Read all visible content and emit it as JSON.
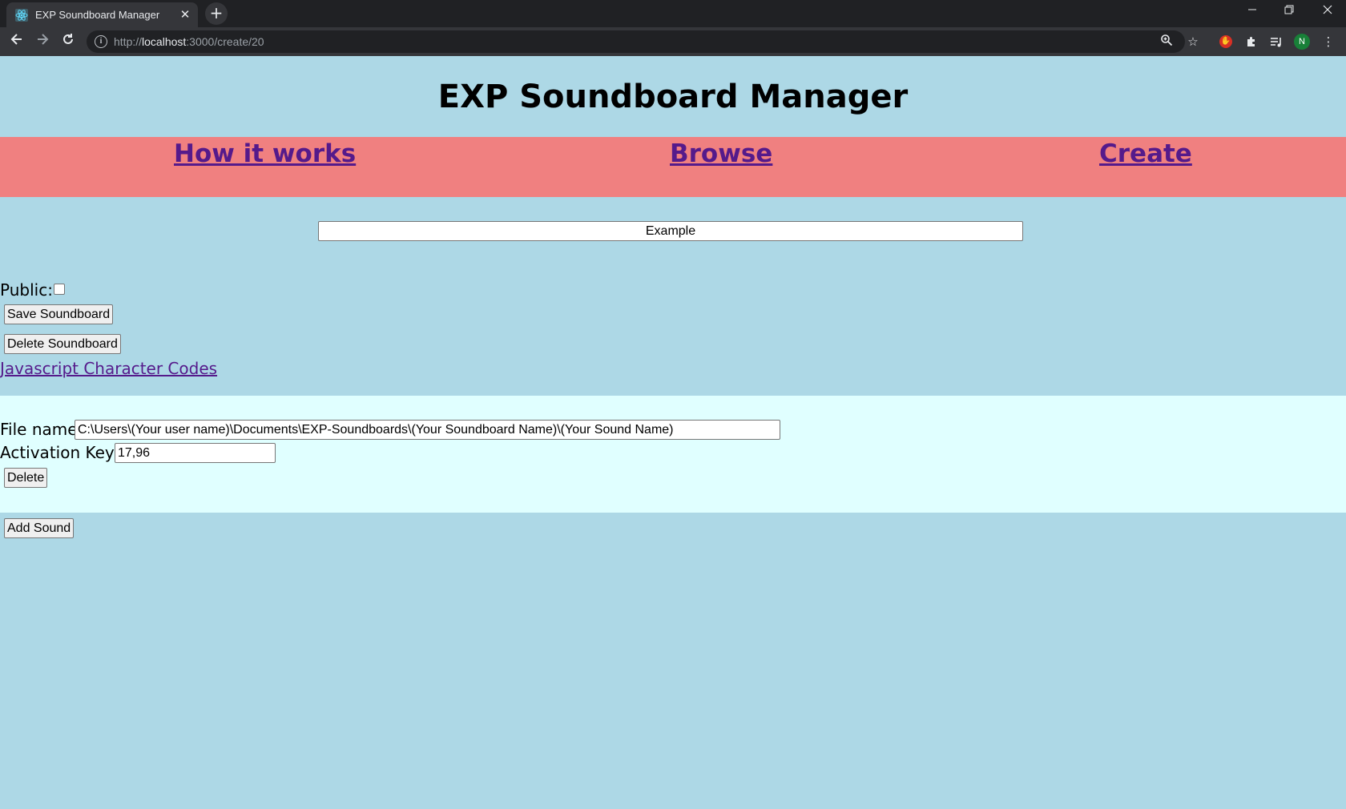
{
  "browser": {
    "tab_title": "EXP Soundboard Manager",
    "url_scheme": "http://",
    "url_host": "localhost",
    "url_rest": ":3000/create/20",
    "profile_initial": "N",
    "icons": {
      "back": "back-arrow-icon",
      "forward": "forward-arrow-icon",
      "reload": "reload-icon",
      "zoom": "zoom-icon",
      "bookmark": "star-icon",
      "menu": "kebab-menu-icon"
    }
  },
  "header": {
    "title": "EXP Soundboard Manager"
  },
  "nav": {
    "how_it_works": "How it works",
    "browse": "Browse",
    "create": "Create"
  },
  "soundboard": {
    "name_value": "Example",
    "public_label": "Public:",
    "public_checked": false,
    "save_label": "Save Soundboard",
    "delete_label": "Delete Soundboard",
    "codes_link": "Javascript Character Codes"
  },
  "sound": {
    "file_name_label": "File name:",
    "file_name_value": "C:\\Users\\(Your user name)\\Documents\\EXP-Soundboards\\(Your Soundboard Name)\\(Your Sound Name)",
    "activation_keys_label": "Activation Keys:",
    "activation_keys_value": "17,96",
    "delete_label": "Delete"
  },
  "add_sound_label": "Add Sound",
  "colors": {
    "page_bg": "#add8e6",
    "nav_bg": "#f08080",
    "sound_panel_bg": "#e0ffff",
    "link": "#551a8b"
  }
}
